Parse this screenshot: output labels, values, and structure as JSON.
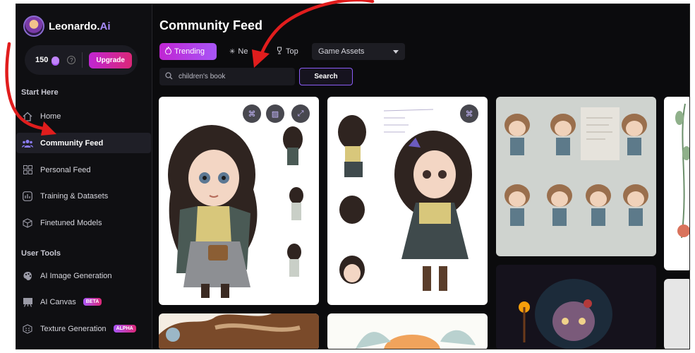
{
  "brand": {
    "name": "Leonardo.",
    "name_suffix": "Ai"
  },
  "credits": {
    "count": "150",
    "help": "?",
    "upgrade_label": "Upgrade"
  },
  "sidebar": {
    "start_title": "Start Here",
    "start_items": [
      {
        "label": "Home",
        "icon": "home-icon"
      },
      {
        "label": "Community Feed",
        "icon": "community-icon",
        "active": true
      },
      {
        "label": "Personal Feed",
        "icon": "grid-icon"
      },
      {
        "label": "Training & Datasets",
        "icon": "training-icon"
      },
      {
        "label": "Finetuned Models",
        "icon": "cube-icon"
      }
    ],
    "tools_title": "User Tools",
    "tools_items": [
      {
        "label": "AI Image Generation",
        "icon": "palette-icon"
      },
      {
        "label": "AI Canvas",
        "icon": "canvas-icon",
        "badge": "BETA"
      },
      {
        "label": "Texture Generation",
        "icon": "texture-icon",
        "badge": "ALPHA"
      }
    ]
  },
  "main": {
    "title": "Community Feed",
    "tabs": [
      {
        "label": "Trending",
        "icon": "fire-icon",
        "active": true
      },
      {
        "label": "Ne",
        "icon": "sparkle-icon"
      },
      {
        "label": "Top",
        "icon": "trophy-icon"
      }
    ],
    "filter": {
      "selected": "Game Assets"
    },
    "search": {
      "value": "children's book",
      "button_label": "Search"
    }
  },
  "colors": {
    "accent": "#a855f7",
    "brand_pink": "#db2777",
    "annotation_red": "#e11d1d",
    "background": "#0b0b0d"
  }
}
